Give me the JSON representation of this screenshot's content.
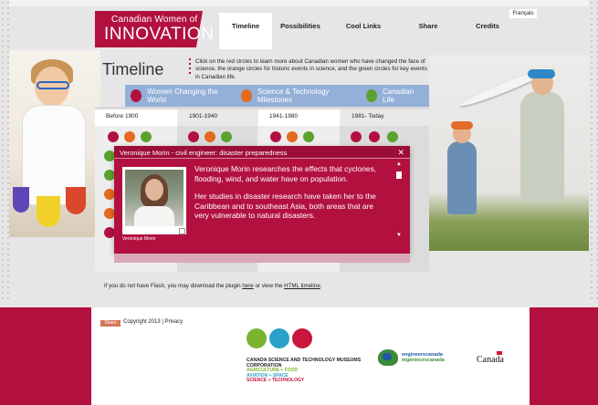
{
  "header": {
    "logo_small": "Canadian Women of",
    "logo_big": "INNOVATION",
    "language_link": "Français",
    "nav": [
      "Timeline",
      "Possibilities",
      "Cool Links",
      "Share",
      "Credits"
    ],
    "active_nav_index": 0
  },
  "timeline": {
    "title": "Timeline",
    "intro": "Click on the red circles to learn more about Canadian women who have changed the face of science, the orange circles for historic events in science, and the green circles for key events in Canadian life.",
    "legend": [
      {
        "label": "Women Changing the World",
        "color": "#b2113f"
      },
      {
        "label": "Science & Technology Milestones",
        "color": "#e36a1f"
      },
      {
        "label": "Canadian Life",
        "color": "#5aa22f"
      }
    ],
    "eras": [
      "Before 1900",
      "1901-1940",
      "1941-1980",
      "1981- Today"
    ]
  },
  "popup": {
    "title": "Veronique Morin - civil engineer: disaster preparedness",
    "close": "✕",
    "caption": "Veronique Morin",
    "paragraphs": [
      "Veronique Morin researches the effects that cyclones, flooding, wind, and water have on population.",
      "Her studies in disaster research have taken her to the Caribbean and to southeast Asia, both areas that are very vulnerable to natural disasters."
    ]
  },
  "flash_note": {
    "before": "If you do not have Flash, you may download the plugin ",
    "link1": "here",
    "middle": " or view the ",
    "link2": "HTML timeline",
    "after": "."
  },
  "footer": {
    "share_label": "Share",
    "copyright": "Copyright 2013 | ",
    "privacy": "Privacy",
    "cstm_name": "CANADA SCIENCE AND TECHNOLOGY MUSEUMS CORPORATION",
    "cstm_lines": [
      {
        "text": "AGRICULTURE + FOOD",
        "color": "#7bb42f"
      },
      {
        "text": "AVIATION + SPACE",
        "color": "#2aa1c8"
      },
      {
        "text": "SCIENCE + TECHNOLOGY",
        "color": "#c8163f"
      }
    ],
    "engineers_en": "engineerscanada",
    "engineers_fr": "ingénieurscanada",
    "canada_wordmark": "Canada"
  }
}
